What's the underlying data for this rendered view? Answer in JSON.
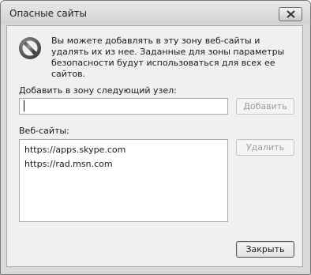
{
  "window": {
    "title": "Опасные сайты"
  },
  "info": {
    "text": "Вы можете добавлять в эту зону  веб-сайты и удалять их из нее. Заданные для зоны параметры безопасности будут использоваться для всех ее сайтов."
  },
  "add_section": {
    "label": "Добавить в зону следующий узел:",
    "input_value": "",
    "add_button": "Добавить"
  },
  "sites_section": {
    "label": "Веб-сайты:",
    "items": [
      "https://apps.skype.com",
      "https://rad.msn.com"
    ],
    "remove_button": "Удалить"
  },
  "footer": {
    "close_button": "Закрыть"
  },
  "icons": {
    "close": "close-icon",
    "warning": "prohibited-icon"
  }
}
